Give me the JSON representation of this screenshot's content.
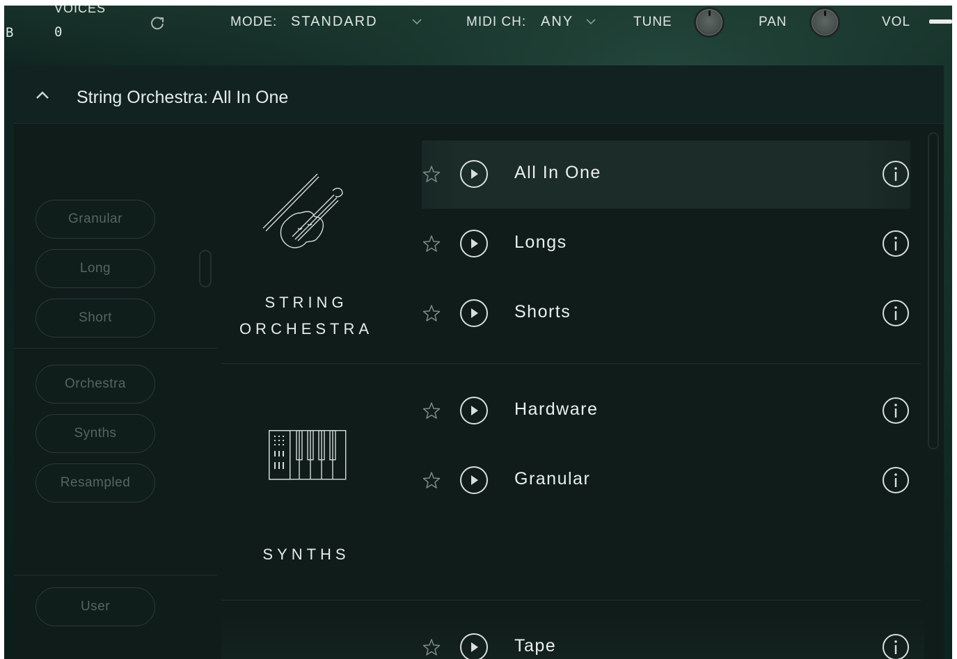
{
  "header": {
    "left_partial": "B",
    "voices_label": "VOICES",
    "voices_value": "0",
    "mode_label": "MODE:",
    "mode_value": "STANDARD",
    "midi_label": "MIDI CH:",
    "midi_value": "ANY",
    "tune_label": "TUNE",
    "pan_label": "PAN",
    "vol_label": "VOL"
  },
  "panel": {
    "title": "String Orchestra: All In One"
  },
  "filters": {
    "group1": [
      "Granular",
      "Long",
      "Short"
    ],
    "group2": [
      "Orchestra",
      "Synths",
      "Resampled"
    ],
    "group3": [
      "User"
    ]
  },
  "categories": [
    {
      "line1": "STRING",
      "line2": "ORCHESTRA",
      "icon": "violin-icon"
    },
    {
      "line1": "SYNTHS",
      "icon": "keyboard-synth-icon"
    }
  ],
  "presets": {
    "string_orchestra": [
      "All In One",
      "Longs",
      "Shorts"
    ],
    "synths": [
      "Hardware",
      "Granular"
    ],
    "next": [
      "Tape"
    ]
  },
  "colors": {
    "background": "#0f1c1a",
    "header": "#163129",
    "active_row": "#1c2c29",
    "text": "#eaf0ed",
    "muted_text": "#56665f"
  }
}
